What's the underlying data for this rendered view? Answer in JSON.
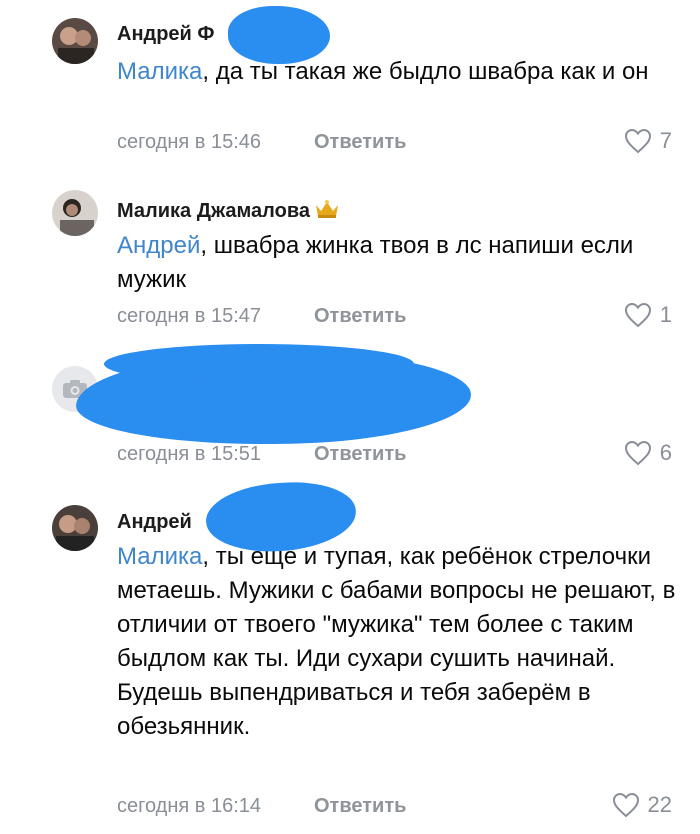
{
  "comments": [
    {
      "author": "Андрей Ф",
      "mention": "Малика",
      "text": ", да ты такая же быдло швабра как и он",
      "time": "сегодня в 15:46",
      "reply": "Ответить",
      "likes": "7"
    },
    {
      "author": "Малика Джамалова",
      "mention": "Андрей",
      "text": ", швабра жинка твоя в лс напиши если мужик",
      "time": "сегодня в 15:47",
      "reply": "Ответить",
      "likes": "1"
    },
    {
      "author": "",
      "mention": "",
      "text": "",
      "time": "сегодня в 15:51",
      "reply": "Ответить",
      "likes": "6"
    },
    {
      "author": "Андрей",
      "mention": "Малика",
      "text": ", ты ещё и тупая, как ребёнок стрелочки метаешь. Мужики с бабами вопросы не решают, в отличии от твоего \"мужика\" тем более с таким быдлом как ты. Иди сухари сушить начинай. Будешь выпендриваться и тебя заберём в обезьянник.",
      "time": "сегодня в 16:14",
      "reply": "Ответить",
      "likes": "22"
    }
  ],
  "colors": {
    "mention": "#3f86cc",
    "meta": "#8a8f97",
    "redaction": "#2a8df0"
  },
  "icons": [
    "heart-icon",
    "camera-icon",
    "crown-icon"
  ]
}
